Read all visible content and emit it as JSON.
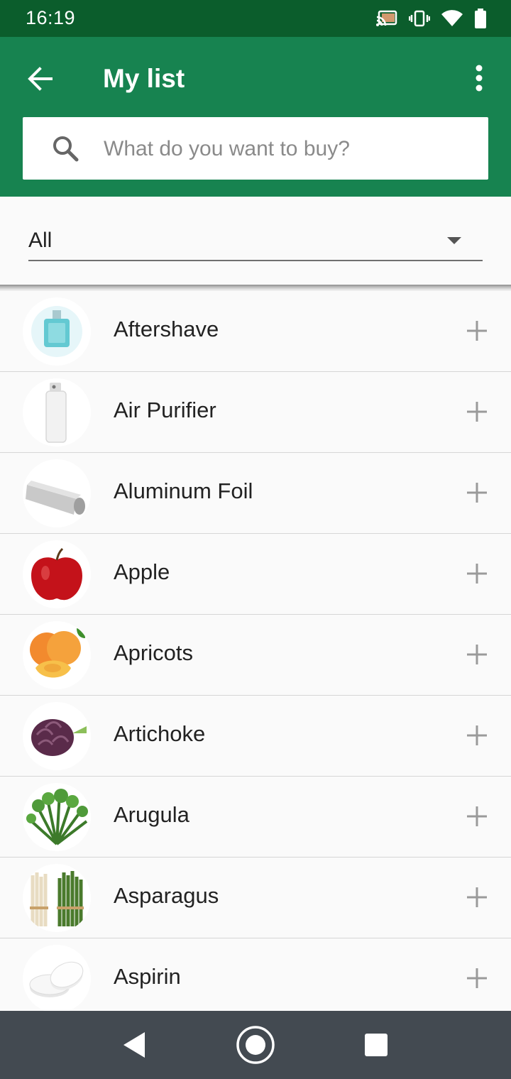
{
  "status": {
    "time": "16:19"
  },
  "appbar": {
    "title": "My list"
  },
  "search": {
    "placeholder": "What do you want to buy?"
  },
  "filter": {
    "selected": "All"
  },
  "items": [
    {
      "label": "Aftershave"
    },
    {
      "label": "Air Purifier"
    },
    {
      "label": "Aluminum Foil"
    },
    {
      "label": "Apple"
    },
    {
      "label": "Apricots"
    },
    {
      "label": "Artichoke"
    },
    {
      "label": "Arugula"
    },
    {
      "label": "Asparagus"
    },
    {
      "label": "Aspirin"
    }
  ],
  "colors": {
    "appbar": "#178350",
    "statusbar": "#0b5d2c",
    "navbar": "#434a51"
  }
}
